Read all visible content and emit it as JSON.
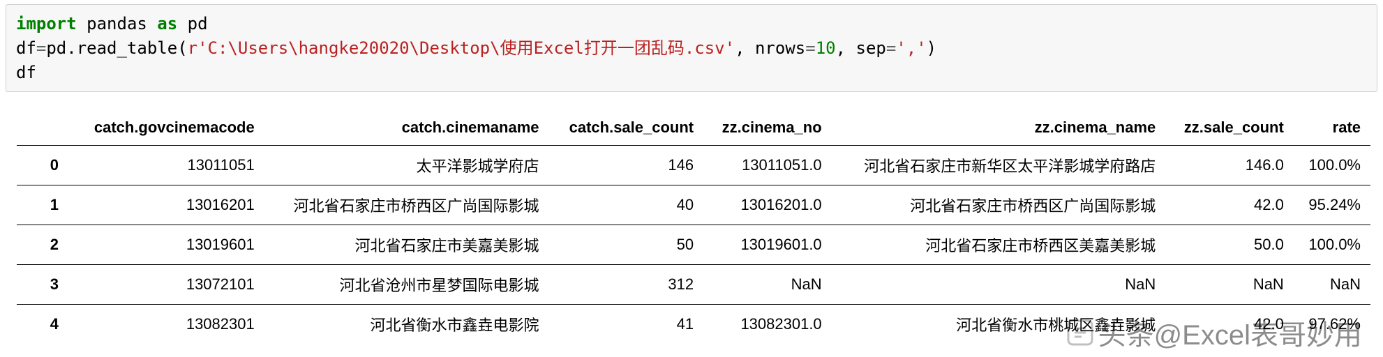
{
  "code": {
    "kw_import": "import",
    "mod": " pandas ",
    "kw_as": "as",
    "alias": " pd",
    "line2_a": "df",
    "line2_eq": "=",
    "line2_b": "pd.read_table(",
    "line2_str": "r'C:\\Users\\hangke20020\\Desktop\\使用Excel打开一团乱码.csv'",
    "line2_c": ", nrows",
    "line2_eq2": "=",
    "line2_num": "10",
    "line2_d": ", sep",
    "line2_eq3": "=",
    "line2_str2": "','",
    "line2_e": ")",
    "line3": "df"
  },
  "table": {
    "columns": [
      "catch.govcinemacode",
      "catch.cinemaname",
      "catch.sale_count",
      "zz.cinema_no",
      "zz.cinema_name",
      "zz.sale_count",
      "rate"
    ],
    "rows": [
      {
        "idx": "0",
        "c0": "13011051",
        "c1": "太平洋影城学府店",
        "c2": "146",
        "c3": "13011051.0",
        "c4": "河北省石家庄市新华区太平洋影城学府路店",
        "c5": "146.0",
        "c6": "100.0%"
      },
      {
        "idx": "1",
        "c0": "13016201",
        "c1": "河北省石家庄市桥西区广尚国际影城",
        "c2": "40",
        "c3": "13016201.0",
        "c4": "河北省石家庄市桥西区广尚国际影城",
        "c5": "42.0",
        "c6": "95.24%"
      },
      {
        "idx": "2",
        "c0": "13019601",
        "c1": "河北省石家庄市美嘉美影城",
        "c2": "50",
        "c3": "13019601.0",
        "c4": "河北省石家庄市桥西区美嘉美影城",
        "c5": "50.0",
        "c6": "100.0%"
      },
      {
        "idx": "3",
        "c0": "13072101",
        "c1": "河北省沧州市星梦国际电影城",
        "c2": "312",
        "c3": "NaN",
        "c4": "NaN",
        "c5": "NaN",
        "c6": "NaN"
      },
      {
        "idx": "4",
        "c0": "13082301",
        "c1": "河北省衡水市鑫垚电影院",
        "c2": "41",
        "c3": "13082301.0",
        "c4": "河北省衡水市桃城区鑫垚影城",
        "c5": "42.0",
        "c6": "97.62%"
      }
    ]
  },
  "watermark": {
    "text": "头条@Excel表哥妙用"
  }
}
